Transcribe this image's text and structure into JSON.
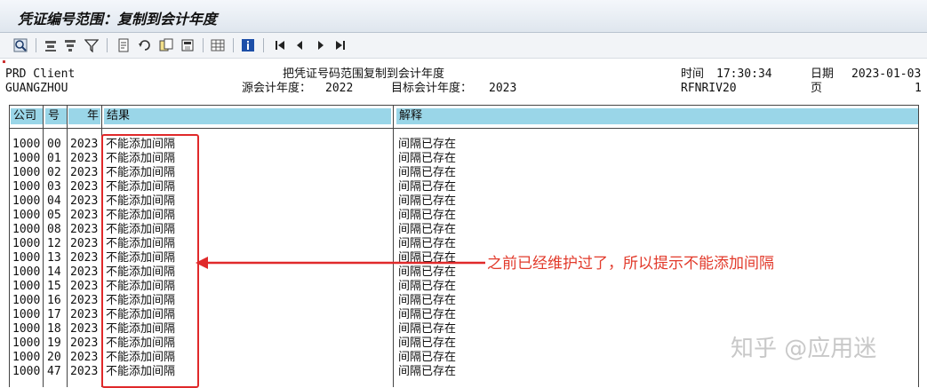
{
  "window": {
    "title": "凭证编号范围：复制到会计年度"
  },
  "toolbar": {
    "icons": [
      "search-icon",
      "filter-icon",
      "sort-icon",
      "filter-funnel-icon",
      "export-icon",
      "refresh-icon",
      "copy-icon",
      "print-icon",
      "grid-icon",
      "info-icon",
      "first-page-icon",
      "prev-page-icon",
      "next-page-icon",
      "last-page-icon"
    ]
  },
  "report": {
    "client": "PRD Client",
    "city": "GUANGZHOU",
    "heading": "把凭证号码范围复制到会计年度",
    "source_year_label": "源会计年度：",
    "source_year": "2022",
    "target_year_label": "目标会计年度：",
    "target_year": "2023",
    "time_label": "时间",
    "time": "17:30:34",
    "date_label": "日期",
    "date": "2023-01-03",
    "program": "RFNRIV20",
    "page_label": "页",
    "page": "1",
    "columns": {
      "company": "公司",
      "number": "号",
      "year": "年",
      "result": "结果",
      "explanation": "解释"
    },
    "rows": [
      {
        "company": "1000",
        "number": "00",
        "year": "2023",
        "result": "不能添加间隔",
        "explanation": "间隔已存在"
      },
      {
        "company": "1000",
        "number": "01",
        "year": "2023",
        "result": "不能添加间隔",
        "explanation": "间隔已存在"
      },
      {
        "company": "1000",
        "number": "02",
        "year": "2023",
        "result": "不能添加间隔",
        "explanation": "间隔已存在"
      },
      {
        "company": "1000",
        "number": "03",
        "year": "2023",
        "result": "不能添加间隔",
        "explanation": "间隔已存在"
      },
      {
        "company": "1000",
        "number": "04",
        "year": "2023",
        "result": "不能添加间隔",
        "explanation": "间隔已存在"
      },
      {
        "company": "1000",
        "number": "05",
        "year": "2023",
        "result": "不能添加间隔",
        "explanation": "间隔已存在"
      },
      {
        "company": "1000",
        "number": "08",
        "year": "2023",
        "result": "不能添加间隔",
        "explanation": "间隔已存在"
      },
      {
        "company": "1000",
        "number": "12",
        "year": "2023",
        "result": "不能添加间隔",
        "explanation": "间隔已存在"
      },
      {
        "company": "1000",
        "number": "13",
        "year": "2023",
        "result": "不能添加间隔",
        "explanation": "间隔已存在"
      },
      {
        "company": "1000",
        "number": "14",
        "year": "2023",
        "result": "不能添加间隔",
        "explanation": "间隔已存在"
      },
      {
        "company": "1000",
        "number": "15",
        "year": "2023",
        "result": "不能添加间隔",
        "explanation": "间隔已存在"
      },
      {
        "company": "1000",
        "number": "16",
        "year": "2023",
        "result": "不能添加间隔",
        "explanation": "间隔已存在"
      },
      {
        "company": "1000",
        "number": "17",
        "year": "2023",
        "result": "不能添加间隔",
        "explanation": "间隔已存在"
      },
      {
        "company": "1000",
        "number": "18",
        "year": "2023",
        "result": "不能添加间隔",
        "explanation": "间隔已存在"
      },
      {
        "company": "1000",
        "number": "19",
        "year": "2023",
        "result": "不能添加间隔",
        "explanation": "间隔已存在"
      },
      {
        "company": "1000",
        "number": "20",
        "year": "2023",
        "result": "不能添加间隔",
        "explanation": "间隔已存在"
      },
      {
        "company": "1000",
        "number": "47",
        "year": "2023",
        "result": "不能添加间隔",
        "explanation": "间隔已存在"
      }
    ]
  },
  "annotation": {
    "text": "之前已经维护过了，所以提示不能添加间隔",
    "color": "#e23a2b"
  },
  "watermark": {
    "text": "知乎 @应用迷"
  },
  "colors": {
    "header_bg": "#9ad6e8",
    "highlight": "#e0292a"
  }
}
